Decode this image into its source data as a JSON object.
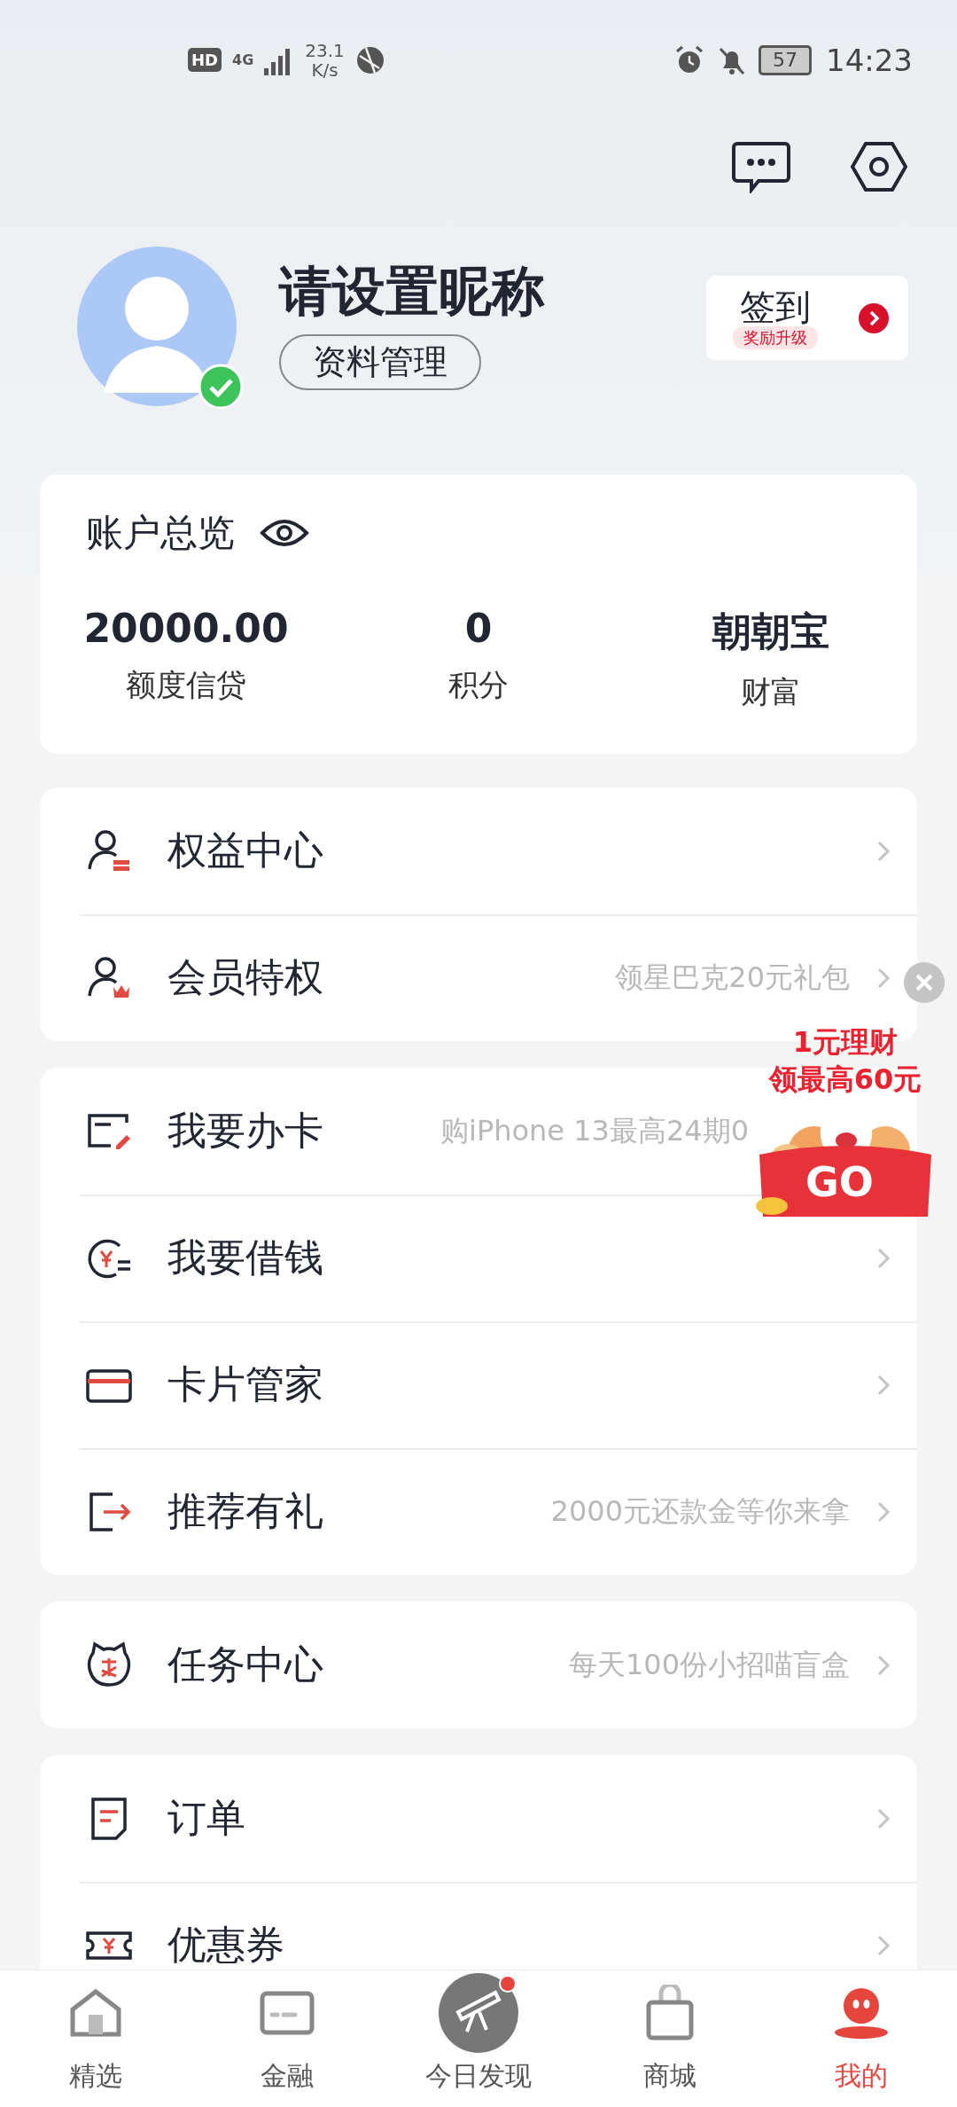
{
  "status_bar": {
    "hd": "HD",
    "network": "4G",
    "speed": "23.1",
    "speed_unit": "K/s",
    "battery": "57",
    "time": "14:23"
  },
  "profile": {
    "nickname": "请设置昵称",
    "verified": true,
    "profile_button": "资料管理",
    "checkin": {
      "label": "签到",
      "tag": "奖励升级"
    }
  },
  "account": {
    "title": "账户总览",
    "stats": [
      {
        "value": "20000.00",
        "label": "额度信贷"
      },
      {
        "value": "0",
        "label": "积分"
      },
      {
        "value": "朝朝宝",
        "label": "财富"
      }
    ]
  },
  "sections": [
    {
      "rows": [
        {
          "kind": "benefits",
          "title": "权益中心",
          "chevron": true
        },
        {
          "kind": "member",
          "title": "会员特权",
          "subtitle": "领星巴克20元礼包",
          "chevron": true
        }
      ]
    },
    {
      "rows": [
        {
          "kind": "apply-card",
          "title": "我要办卡",
          "subtitle": "购iPhone 13最高24期0",
          "chevron": false
        },
        {
          "kind": "loan",
          "title": "我要借钱",
          "chevron": true
        },
        {
          "kind": "cards",
          "title": "卡片管家",
          "chevron": true
        },
        {
          "kind": "referral",
          "title": "推荐有礼",
          "subtitle": "2000元还款金等你来拿",
          "chevron": true
        }
      ]
    },
    {
      "rows": [
        {
          "kind": "tasks",
          "title": "任务中心",
          "subtitle": "每天100份小招喵盲盒",
          "chevron": true
        }
      ]
    },
    {
      "rows": [
        {
          "kind": "orders",
          "title": "订单",
          "chevron": true
        },
        {
          "kind": "coupons",
          "title": "优惠券",
          "chevron": true
        }
      ]
    }
  ],
  "promo": {
    "lines": [
      "1元理财",
      "领最高60元"
    ],
    "button": "GO"
  },
  "tabs": [
    {
      "kind": "home",
      "label": "精选",
      "selected": false,
      "dot": false
    },
    {
      "kind": "finance",
      "label": "金融",
      "selected": false,
      "dot": false
    },
    {
      "kind": "discover",
      "label": "今日发现",
      "selected": false,
      "dot": true
    },
    {
      "kind": "mall",
      "label": "商城",
      "selected": false,
      "dot": false
    },
    {
      "kind": "mine",
      "label": "我的",
      "selected": true,
      "dot": false
    }
  ]
}
